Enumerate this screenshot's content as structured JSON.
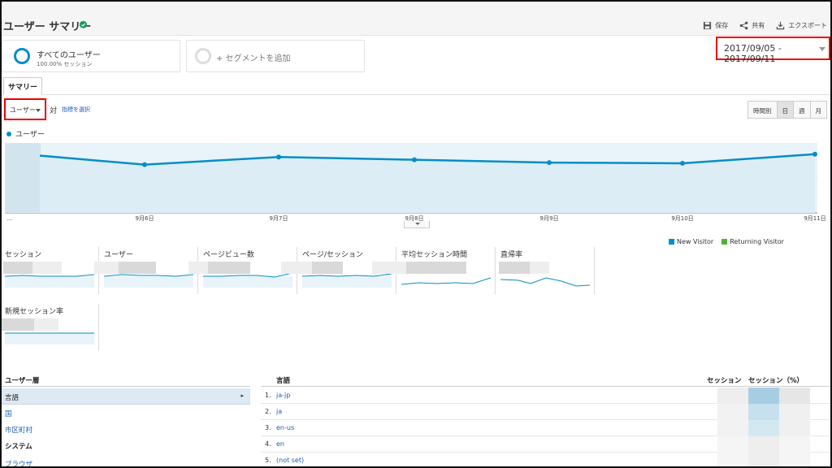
{
  "header": {
    "title": "ユーザー サマリー",
    "actions": [
      {
        "label": "保存",
        "icon": "save-icon"
      },
      {
        "label": "共有",
        "icon": "share-icon"
      },
      {
        "label": "エクスポート",
        "icon": "export-icon"
      }
    ]
  },
  "segments": {
    "active_title": "すべてのユーザー",
    "active_sub": "100.00% セッション",
    "add_label": "+ セグメントを追加"
  },
  "date_range": "2017/09/05 - 2017/09/11",
  "tabs": [
    "サマリー"
  ],
  "metric_selector": {
    "value": "ユーザー",
    "vs": "対",
    "select_link": "指標を選択"
  },
  "granularity": [
    "時間別",
    "日",
    "週",
    "月"
  ],
  "granularity_active": "日",
  "chart_legend": "ユーザー",
  "chart_data": {
    "type": "area",
    "x": [
      "...",
      "9月6日",
      "9月7日",
      "9月8日",
      "9月9日",
      "9月10日",
      "9月11日"
    ],
    "values": [
      0.82,
      0.69,
      0.8,
      0.76,
      0.72,
      0.71,
      0.84
    ],
    "ylabel": "",
    "note_values": "y axis values hidden in screenshot; relative levels only"
  },
  "pie_legend": [
    {
      "label": "New Visitor",
      "color": "#058dc7"
    },
    {
      "label": "Returning Visitor",
      "color": "#50b432"
    }
  ],
  "metrics": [
    {
      "label": "セッション"
    },
    {
      "label": "ユーザー"
    },
    {
      "label": "ページビュー数"
    },
    {
      "label": "ページ/セッション"
    },
    {
      "label": "平均セッション時間"
    },
    {
      "label": "直帰率"
    },
    {
      "label": "新規セッション率"
    }
  ],
  "dimensions": {
    "header": "ユーザー層",
    "items": [
      "言語",
      "国",
      "市区町村"
    ],
    "selected": "言語",
    "section2": "システム",
    "section2_items": [
      "ブラウザ"
    ]
  },
  "table": {
    "col_lang": "言語",
    "col_sessions": "セッション",
    "col_sessions_pct": "セッション（%）",
    "rows": [
      {
        "idx": "1.",
        "lang": "ja-jp"
      },
      {
        "idx": "2.",
        "lang": "ja"
      },
      {
        "idx": "3.",
        "lang": "en-us"
      },
      {
        "idx": "4.",
        "lang": "en"
      },
      {
        "idx": "5.",
        "lang": "(not set)"
      }
    ]
  },
  "colors": {
    "accent": "#058dc7",
    "highlight": "#e00000",
    "area": "#e8f4fa"
  }
}
